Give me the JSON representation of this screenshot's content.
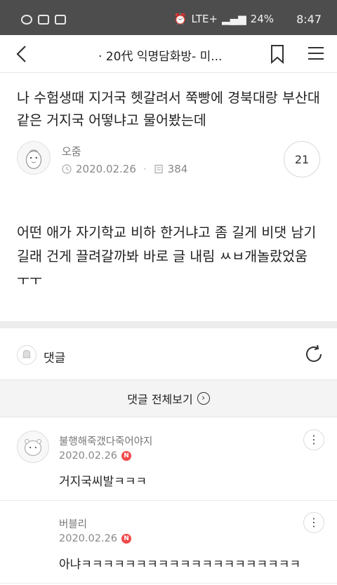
{
  "status_bar": {
    "network": "LTE+",
    "battery": "24%",
    "time": "8:47"
  },
  "app_bar": {
    "title": "· 20代 익명담화방- 미..."
  },
  "post": {
    "title": "나 수험생때 지거국 헷갈려서 쭉빵에 경북대랑 부산대같은 거지국 어떻냐고 물어봤는데",
    "author": "오줌",
    "date": "2020.02.26",
    "views": "384",
    "comment_count": "21",
    "body": "어떤 애가 자기학교 비하 한거냐고 좀 길게 비댓 남기길래 건게 끌려갈까봐 바로 글 내림 ㅆㅂ개놀랐었움 ㅜㅜ"
  },
  "comments_section": {
    "label": "댓글",
    "view_all_label": "댓글 전체보기",
    "new_badge": "N",
    "items": [
      {
        "author": "불행해죽갰다죽어야지",
        "date": "2020.02.26",
        "text": "거지국씨발ㅋㅋㅋ"
      },
      {
        "author": "버블리",
        "date": "2020.02.26",
        "text": "아냐ㅋㅋㅋㅋㅋㅋㅋㅋㅋㅋㅋㅋㅋㅋㅋㅋㅋㅋㅋㅋ"
      }
    ]
  },
  "icons": [
    "back-arrow-icon",
    "bookmark-icon",
    "menu-icon",
    "clock-icon",
    "views-icon",
    "bell-icon",
    "refresh-icon",
    "chevron-right-icon",
    "more-icon"
  ]
}
